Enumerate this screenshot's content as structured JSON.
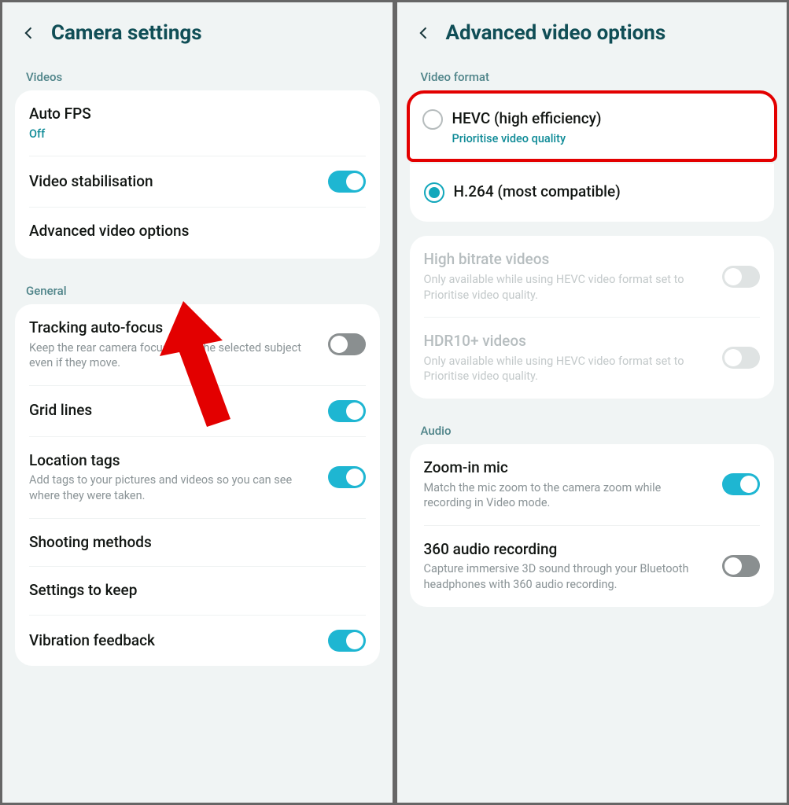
{
  "left": {
    "title": "Camera settings",
    "sections": {
      "videos": {
        "label": "Videos",
        "items": {
          "auto_fps": {
            "title": "Auto FPS",
            "value": "Off"
          },
          "video_stabilisation": {
            "title": "Video stabilisation",
            "toggle": "on"
          },
          "advanced_video_options": {
            "title": "Advanced video options"
          }
        }
      },
      "general": {
        "label": "General",
        "items": {
          "tracking_af": {
            "title": "Tracking auto-focus",
            "sub": "Keep the rear camera focused on the selected subject even if they move.",
            "toggle": "off"
          },
          "grid_lines": {
            "title": "Grid lines",
            "toggle": "on"
          },
          "location_tags": {
            "title": "Location tags",
            "sub": "Add tags to your pictures and videos so you can see where they were taken.",
            "toggle": "on"
          },
          "shooting_methods": {
            "title": "Shooting methods"
          },
          "settings_to_keep": {
            "title": "Settings to keep"
          },
          "vibration_feedback": {
            "title": "Vibration feedback",
            "toggle": "on"
          }
        }
      }
    }
  },
  "right": {
    "title": "Advanced video options",
    "sections": {
      "video_format": {
        "label": "Video format",
        "options": {
          "hevc": {
            "title": "HEVC (high efficiency)",
            "sub": "Prioritise video quality",
            "selected": false
          },
          "h264": {
            "title": "H.264 (most compatible)",
            "selected": true
          }
        }
      },
      "quality": {
        "items": {
          "high_bitrate": {
            "title": "High bitrate videos",
            "sub": "Only available while using HEVC video format set to Prioritise video quality.",
            "enabled": false
          },
          "hdr10": {
            "title": "HDR10+ videos",
            "sub": "Only available while using HEVC video format set to Prioritise video quality.",
            "enabled": false
          }
        }
      },
      "audio": {
        "label": "Audio",
        "items": {
          "zoom_mic": {
            "title": "Zoom-in mic",
            "sub": "Match the mic zoom to the camera zoom while recording in Video mode.",
            "toggle": "on"
          },
          "audio_360": {
            "title": "360 audio recording",
            "sub": "Capture immersive 3D sound through your Bluetooth headphones with 360 audio recording.",
            "toggle": "off"
          }
        }
      }
    }
  }
}
